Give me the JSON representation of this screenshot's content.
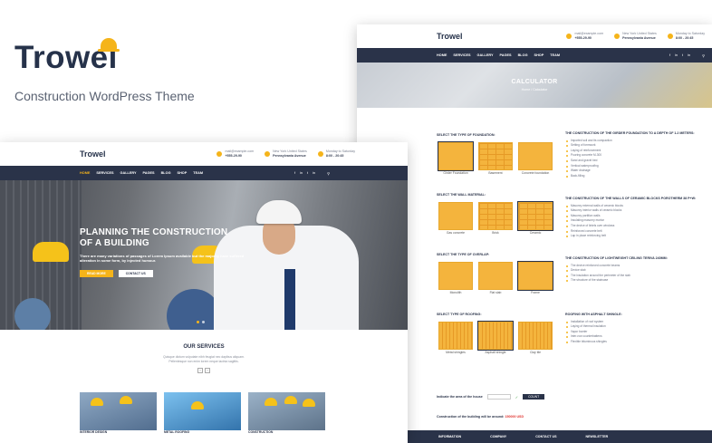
{
  "brand": {
    "name": "Trowel",
    "subtitle": "Construction WordPress Theme"
  },
  "site_header": {
    "logo": "Trowel",
    "contact": {
      "email": "mail@example.com",
      "phone": "+555-29-90"
    },
    "address": {
      "line1": "New York United States",
      "line2": "Pennsylvania Avenue"
    },
    "hours": {
      "line1": "Monday to Saturday",
      "line2": "8:00 - 20:45"
    }
  },
  "nav": {
    "items": [
      "HOME",
      "SERVICES",
      "GALLERY",
      "PAGES",
      "BLOG",
      "SHOP",
      "TEAM"
    ],
    "social": [
      "f",
      "in",
      "t",
      "in"
    ],
    "search_icon": "search-icon"
  },
  "calculator": {
    "title": "CALCULATOR",
    "breadcrumb": "Home / Calculator",
    "sections": [
      {
        "label": "SELECT THE TYPE OF FOUNDATION:",
        "options": [
          "Girder Foundation",
          "Basement",
          "Concrete foundation"
        ]
      },
      {
        "label": "SELECT THE WALL MATERIAL:",
        "options": [
          "Gas concrete",
          "Brick",
          "Ceramic"
        ]
      },
      {
        "label": "SELECT THE TYPE OF OVERLAP:",
        "options": [
          "Monolith",
          "Flat slab",
          "Frame"
        ]
      },
      {
        "label": "SELECT TYPE OF ROOFING:",
        "options": [
          "Metal shingles",
          "Asphalt shingle",
          "Clay tile"
        ]
      }
    ],
    "info": [
      {
        "heading": "THE CONSTRUCTION OF THE GIRDER FOUNDATION TO A DEPTH OF 1.2 METERS:",
        "items": [
          "Imported soil and its compaction",
          "Setting of formwork",
          "Laying of reinforcement",
          "Pouring concrete M-300",
          "Sand and gravel bed",
          "Vertical waterproofing",
          "Water drainage",
          "Back-filling"
        ]
      },
      {
        "heading": "THE CONSTRUCTION OF THE WALLS OF CERAMIC BLOCKS POROTHERM 38 P+W:",
        "items": [
          "Masonry external walls of ceramic blocks",
          "Masonry interior walls of ceramic blocks",
          "Masonry partition walls",
          "Insulating masonry mortar",
          "The device of lintels over windows",
          "Reinforced concrete belt",
          "Lap in place reinforcing belt"
        ]
      },
      {
        "heading": "THE CONSTRUCTION OF LIGHTWEIGHT CEILING TERIVA 240MM:",
        "items": [
          "The device reinforced concrete beams",
          "Device slab",
          "The insulation around the perimeter of the slab",
          "The structure of the staircase"
        ]
      },
      {
        "heading": "ROOFING WITH ASPHALT SHINGLE:",
        "items": [
          "Installation of roof system",
          "Laying of thermal insulation",
          "Vapor barrier",
          "Inter-row counterbattens",
          "Flexible bituminous shingles"
        ]
      }
    ],
    "area_label": "Indicate the area of the house",
    "count_button": "COUNT",
    "result_label": "Construction of the building will be around:",
    "result_value": "150000 USD"
  },
  "footer": [
    "INFORMATION",
    "COMPANY",
    "CONTACT US",
    "NEWSLETTER"
  ],
  "hero": {
    "title_line1": "PLANNING THE CONSTRUCTION",
    "title_line2": "OF A BUILDING",
    "text": "There are many variations of passages of Lorem Ipsum available but the majority have suffered alteration in some form, by injected humour.",
    "primary_button": "READ MORE",
    "secondary_button": "CONTACT US"
  },
  "services": {
    "title": "OUR SERVICES",
    "description_line1": "Quisque dictum vulputate nibh feugiat nec dapibus aliquam.",
    "description_line2": "Pellentesque non enim lorem neque lacinia sagittis.",
    "cards": [
      "INTERIOR DESIGN",
      "METAL ROOFING",
      "CONSTRUCTION"
    ]
  },
  "colors": {
    "accent": "#f5b41a",
    "navy": "#2a3349",
    "result": "#e0332f"
  }
}
